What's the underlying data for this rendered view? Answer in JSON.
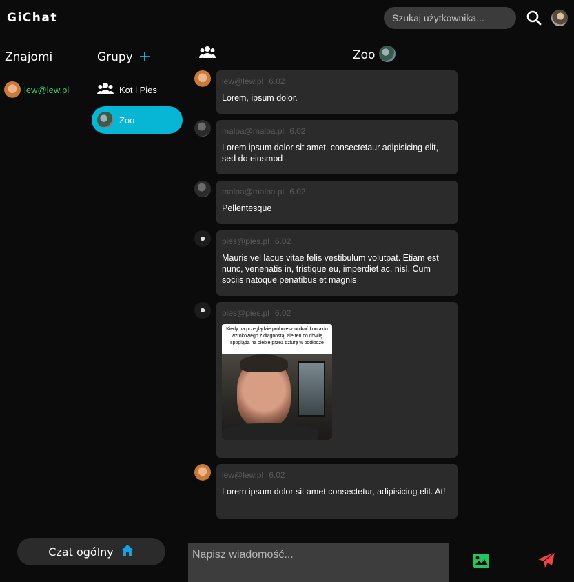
{
  "app": {
    "brand": "GiChat"
  },
  "search": {
    "placeholder": "Szukaj użytkownika..."
  },
  "icons": {
    "search": "search-icon",
    "users": "users-icon",
    "plus": "plus-icon",
    "home": "home-icon",
    "image": "image-icon",
    "send": "send-icon"
  },
  "colors": {
    "accent": "#06b6d4",
    "friend_name": "#3bd16f",
    "send": "#ef4444",
    "image_button": "#22c55e",
    "home_icon": "#1a9fe0"
  },
  "friends": {
    "heading": "Znajomi",
    "items": [
      {
        "name": "lew@lew.pl"
      }
    ]
  },
  "groups": {
    "heading": "Grupy",
    "add_label": "+",
    "items": [
      {
        "name": "Kot i Pies"
      },
      {
        "name": "Zoo"
      }
    ]
  },
  "chat": {
    "title": "Zoo",
    "messages": [
      {
        "author": "lew@lew.pl",
        "time": "6.02",
        "text": "Lorem, ipsum dolor."
      },
      {
        "author": "malpa@malpa.pl",
        "time": "6.02",
        "text": "Lorem ipsum dolor sit amet, consectetaur adipisicing elit, sed do eiusmod"
      },
      {
        "author": "malpa@malpa.pl",
        "time": "6.02",
        "text": "Pellentesque"
      },
      {
        "author": "pies@pies.pl",
        "time": "6.02",
        "text": "Mauris vel lacus vitae felis vestibulum volutpat. Etiam est nunc, venenatis in, tristique eu, imperdiet ac, nisl. Cum sociis natoque penatibus et magnis"
      },
      {
        "author": "pies@pies.pl",
        "time": "6.02",
        "image_caption": "Kiedy na przeglądzie próbujesz unikać kontaktu wzrokowego z diagnostą, ale ten co chwilę spogląda na ciebie przez dziurę w podłodze"
      },
      {
        "author": "lew@lew.pl",
        "time": "6.02",
        "text": "Lorem ipsum dolor sit amet consectetur, adipisicing elit. At!"
      }
    ]
  },
  "footer": {
    "home_label": "Czat ogólny",
    "composer_placeholder": "Napisz wiadomość..."
  }
}
